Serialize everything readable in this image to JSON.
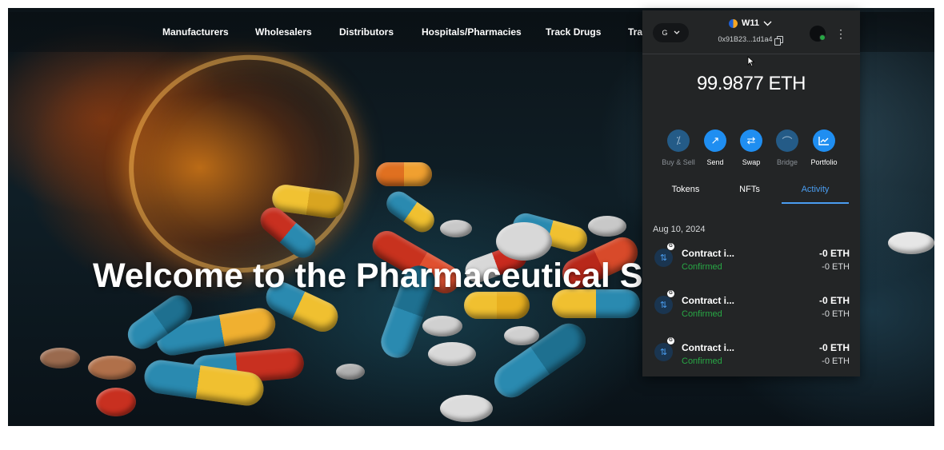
{
  "navbar": {
    "links": [
      "Manufacturers",
      "Wholesalers",
      "Distributors",
      "Hospitals/Pharmacies",
      "Track Drugs",
      "Tra"
    ]
  },
  "hero": {
    "title": "Welcome to the Pharmaceutical S"
  },
  "wallet": {
    "network_label": "G",
    "account_name": "W11",
    "address": "0x91B23...1d1a4",
    "balance": "99.9877 ETH",
    "actions": [
      {
        "label": "Buy & Sell",
        "icon": "buy-sell-icon",
        "disabled": true
      },
      {
        "label": "Send",
        "icon": "send-icon",
        "disabled": false
      },
      {
        "label": "Swap",
        "icon": "swap-icon",
        "disabled": false
      },
      {
        "label": "Bridge",
        "icon": "bridge-icon",
        "disabled": true
      },
      {
        "label": "Portfolio",
        "icon": "portfolio-icon",
        "disabled": false
      }
    ],
    "tabs": [
      {
        "label": "Tokens",
        "active": false
      },
      {
        "label": "NFTs",
        "active": false
      },
      {
        "label": "Activity",
        "active": true
      }
    ],
    "activity": {
      "date": "Aug 10, 2024",
      "items": [
        {
          "name": "Contract i...",
          "status": "Confirmed",
          "amount": "-0 ETH",
          "sub_amount": "-0 ETH",
          "badge": "G"
        },
        {
          "name": "Contract i...",
          "status": "Confirmed",
          "amount": "-0 ETH",
          "sub_amount": "-0 ETH",
          "badge": "G"
        },
        {
          "name": "Contract i...",
          "status": "Confirmed",
          "amount": "-0 ETH",
          "sub_amount": "-0 ETH",
          "badge": "G"
        }
      ]
    },
    "colors": {
      "accent": "#1f8ef1",
      "confirmed": "#28a745",
      "background": "#232526"
    }
  }
}
